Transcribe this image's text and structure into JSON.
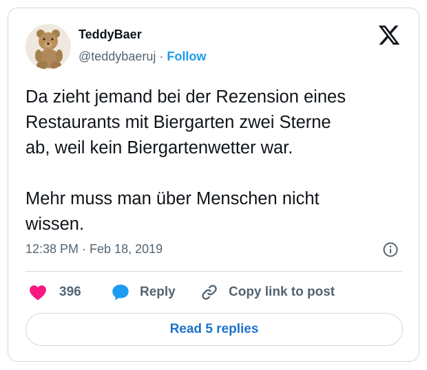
{
  "author": {
    "name": "TeddyBaer",
    "handle": "@teddybaeruj",
    "separator": "·",
    "follow_label": "Follow",
    "avatar_icon": "teddy-bear-avatar"
  },
  "platform_icon": "x-logo-icon",
  "tweet": {
    "text": "Da zieht jemand bei der Rezension eines\nRestaurants mit Biergarten zwei Sterne\nab, weil kein Biergartenwetter war.\n\nMehr muss man über Menschen nicht\nwissen."
  },
  "timestamp": "12:38 PM · Feb 18, 2019",
  "actions": {
    "likes_count": "396",
    "reply_label": "Reply",
    "copy_link_label": "Copy link to post"
  },
  "read_replies_label": "Read 5 replies",
  "colors": {
    "accent": "#1d9bf0",
    "heart": "#f91880",
    "text_secondary": "#536471",
    "border": "#cfd9de"
  }
}
